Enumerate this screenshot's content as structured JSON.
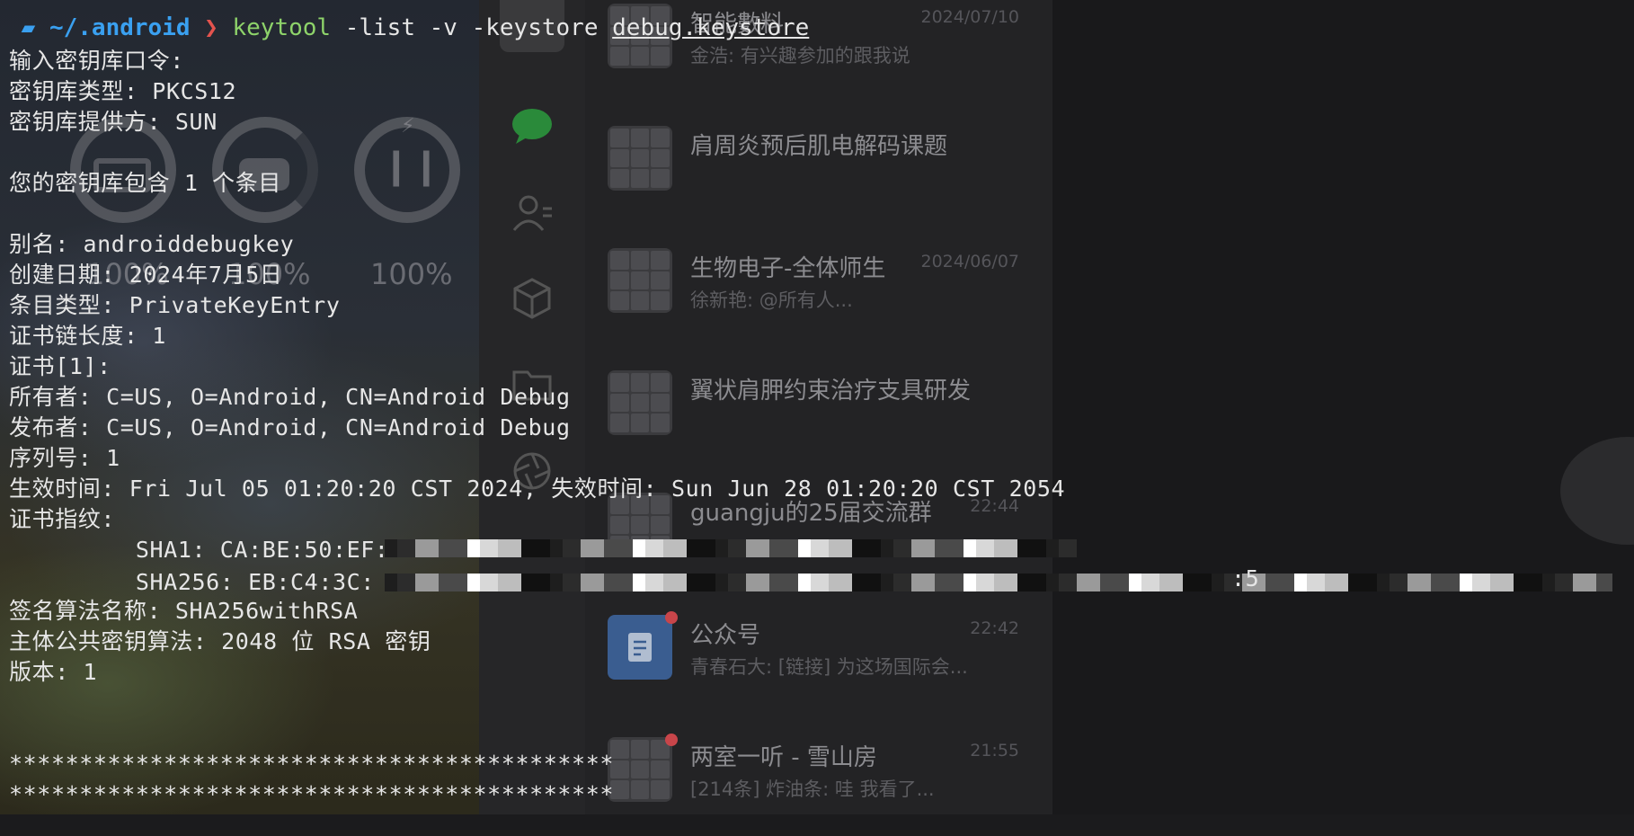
{
  "terminal": {
    "prompt": {
      "apple_icon": "apple-logo",
      "folder_icon": "folder-icon",
      "path": "~/.android",
      "arrow": "❯",
      "command": "keytool",
      "args": " -list -v -keystore ",
      "file": "debug.keystore"
    },
    "lines": [
      "输入密钥库口令:",
      "密钥库类型: PKCS12",
      "密钥库提供方: SUN",
      "",
      "您的密钥库包含 1 个条目",
      "",
      "别名: androiddebugkey",
      "创建日期: 2024年7月5日",
      "条目类型: PrivateKeyEntry",
      "证书链长度: 1",
      "证书[1]:",
      "所有者: C=US, O=Android, CN=Android Debug",
      "发布者: C=US, O=Android, CN=Android Debug",
      "序列号: 1",
      "生效时间: Fri Jul 05 01:20:20 CST 2024, 失效时间: Sun Jun 28 01:20:20 CST 2054",
      "证书指纹:",
      "         SHA1: CA:BE:50:EF:",
      "         SHA256: EB:C4:3C:",
      "签名算法名称: SHA256withRSA",
      "主体公共密钥算法: 2048 位 RSA 密钥",
      "版本: 1",
      "",
      "",
      "*******************************************",
      "*******************************************"
    ],
    "sha256_tail": ":5"
  },
  "widgets": {
    "battery_levels": [
      "100%",
      "100%",
      "100%"
    ],
    "levels_fraction": [
      1.0,
      1.0,
      1.0
    ]
  },
  "sidebar": {
    "icons": [
      "chat-bubble-icon",
      "contacts-icon",
      "cube-icon",
      "folder-icon",
      "aperture-icon"
    ]
  },
  "chats": [
    {
      "name": "智能數料",
      "preview": "金浩: 有兴趣参加的跟我说",
      "time": "2024/07/10"
    },
    {
      "name": "肩周炎预后肌电解码课题",
      "preview": "",
      "time": ""
    },
    {
      "name": "生物电子-全体师生",
      "preview": "徐新艳: @所有人...",
      "time": "2024/06/07"
    },
    {
      "name": "翼状肩胛约束治疗支具研发",
      "preview": "",
      "time": ""
    },
    {
      "name": "guangju的25届交流群",
      "preview": "",
      "time": "22:44"
    },
    {
      "name": "公众号",
      "preview": "青春石大: [链接] 为这场国际会...",
      "time": "22:42"
    },
    {
      "name": "两室一听 - 雪山房",
      "preview": "[214条] 炸油条: 哇 我看了...",
      "time": "21:55"
    }
  ],
  "colors": {
    "prompt_path": "#3aa0f0",
    "prompt_arrow": "#e3534e",
    "command": "#8ed36a",
    "text": "#e6e6e6"
  }
}
